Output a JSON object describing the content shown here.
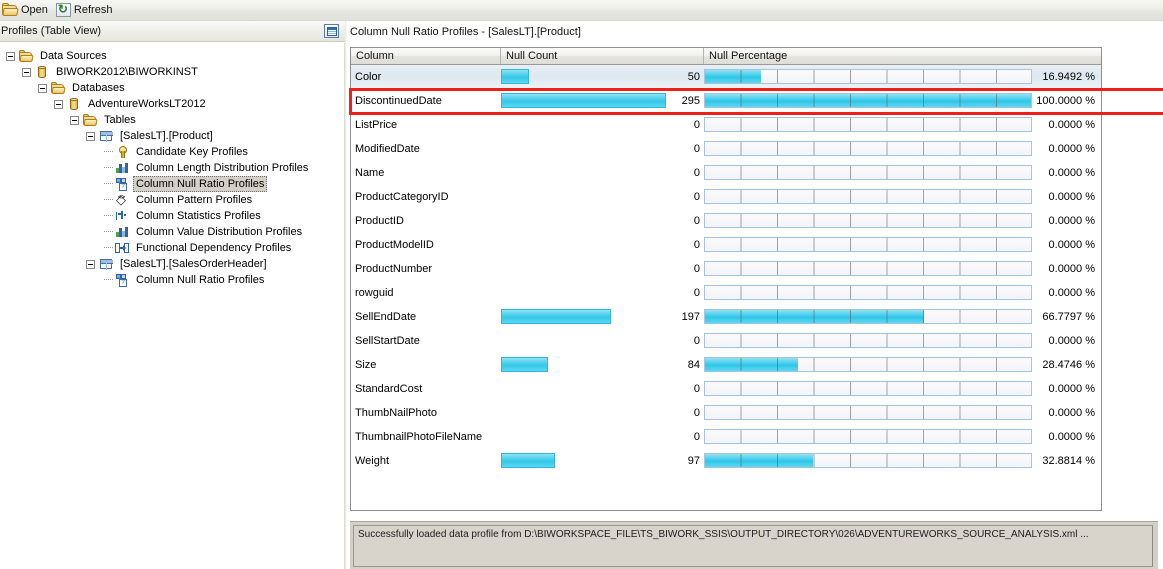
{
  "toolbar": {
    "open_label": "Open",
    "refresh_label": "Refresh",
    "open_icon": "folder-open-icon",
    "refresh_icon": "refresh-icon"
  },
  "left_panel": {
    "header_title": "Profiles (Table View)",
    "view_toggle_icon": "table-view-icon",
    "tree": [
      {
        "label": "Data Sources",
        "depth": 0,
        "icon": "folder-icon",
        "expander": true,
        "selected": false
      },
      {
        "label": "BIWORK2012\\BIWORKINST",
        "depth": 1,
        "icon": "database-server-icon",
        "expander": true,
        "selected": false
      },
      {
        "label": "Databases",
        "depth": 2,
        "icon": "folder-icon",
        "expander": true,
        "selected": false
      },
      {
        "label": "AdventureWorksLT2012",
        "depth": 3,
        "icon": "database-icon",
        "expander": true,
        "selected": false
      },
      {
        "label": "Tables",
        "depth": 4,
        "icon": "folder-icon",
        "expander": true,
        "selected": false
      },
      {
        "label": "[SalesLT].[Product]",
        "depth": 5,
        "icon": "table-icon",
        "expander": true,
        "selected": false
      },
      {
        "label": "Candidate Key Profiles",
        "depth": 6,
        "icon": "key-icon",
        "expander": false,
        "selected": false
      },
      {
        "label": "Column Length Distribution Profiles",
        "depth": 6,
        "icon": "bar-chart-icon",
        "expander": false,
        "selected": false
      },
      {
        "label": "Column Null Ratio Profiles",
        "depth": 6,
        "icon": "null-ratio-icon",
        "expander": false,
        "selected": true
      },
      {
        "label": "Column Pattern Profiles",
        "depth": 6,
        "icon": "pattern-icon",
        "expander": false,
        "selected": false
      },
      {
        "label": "Column Statistics Profiles",
        "depth": 6,
        "icon": "statistics-icon",
        "expander": false,
        "selected": false
      },
      {
        "label": "Column Value Distribution Profiles",
        "depth": 6,
        "icon": "bar-chart-icon",
        "expander": false,
        "selected": false
      },
      {
        "label": "Functional Dependency Profiles",
        "depth": 6,
        "icon": "dependency-icon",
        "expander": false,
        "selected": false
      },
      {
        "label": "[SalesLT].[SalesOrderHeader]",
        "depth": 5,
        "icon": "table-icon",
        "expander": true,
        "selected": false
      },
      {
        "label": "Column Null Ratio Profiles",
        "depth": 6,
        "icon": "null-ratio-icon",
        "expander": false,
        "selected": false
      }
    ]
  },
  "main": {
    "profile_title": "Column Null Ratio Profiles  -  [SalesLT].[Product]",
    "columns": [
      "Column",
      "Null Count",
      "Null Percentage"
    ],
    "percent_suffix": "%",
    "count_bar_max": 295,
    "rows": [
      {
        "column": "Color",
        "null_count": 50,
        "null_percentage": "16.9492",
        "selected": true
      },
      {
        "column": "DiscontinuedDate",
        "null_count": 295,
        "null_percentage": "100.0000",
        "selected": false
      },
      {
        "column": "ListPrice",
        "null_count": 0,
        "null_percentage": "0.0000",
        "selected": false
      },
      {
        "column": "ModifiedDate",
        "null_count": 0,
        "null_percentage": "0.0000",
        "selected": false
      },
      {
        "column": "Name",
        "null_count": 0,
        "null_percentage": "0.0000",
        "selected": false
      },
      {
        "column": "ProductCategoryID",
        "null_count": 0,
        "null_percentage": "0.0000",
        "selected": false
      },
      {
        "column": "ProductID",
        "null_count": 0,
        "null_percentage": "0.0000",
        "selected": false
      },
      {
        "column": "ProductModelID",
        "null_count": 0,
        "null_percentage": "0.0000",
        "selected": false
      },
      {
        "column": "ProductNumber",
        "null_count": 0,
        "null_percentage": "0.0000",
        "selected": false
      },
      {
        "column": "rowguid",
        "null_count": 0,
        "null_percentage": "0.0000",
        "selected": false
      },
      {
        "column": "SellEndDate",
        "null_count": 197,
        "null_percentage": "66.7797",
        "selected": false
      },
      {
        "column": "SellStartDate",
        "null_count": 0,
        "null_percentage": "0.0000",
        "selected": false
      },
      {
        "column": "Size",
        "null_count": 84,
        "null_percentage": "28.4746",
        "selected": false
      },
      {
        "column": "StandardCost",
        "null_count": 0,
        "null_percentage": "0.0000",
        "selected": false
      },
      {
        "column": "ThumbNailPhoto",
        "null_count": 0,
        "null_percentage": "0.0000",
        "selected": false
      },
      {
        "column": "ThumbnailPhotoFileName",
        "null_count": 0,
        "null_percentage": "0.0000",
        "selected": false
      },
      {
        "column": "Weight",
        "null_count": 97,
        "null_percentage": "32.8814",
        "selected": false
      }
    ]
  },
  "status": {
    "message": "Successfully loaded data profile from D:\\BIWORKSPACE_FILE\\TS_BIWORK_SSIS\\OUTPUT_DIRECTORY\\026\\ADVENTUREWORKS_SOURCE_ANALYSIS.xml ..."
  },
  "colors": {
    "bar_fill": "#33c8ea",
    "bar_border": "#31b9d9",
    "highlight_border": "#ee2018",
    "selection_bg": "#d4d0c8",
    "chrome_bg": "#ece9d8"
  },
  "chart_data": {
    "type": "bar",
    "title": "Column Null Ratio Profiles  -  [SalesLT].[Product]",
    "xlabel": "",
    "ylabel": "Column",
    "categories": [
      "Color",
      "DiscontinuedDate",
      "ListPrice",
      "ModifiedDate",
      "Name",
      "ProductCategoryID",
      "ProductID",
      "ProductModelID",
      "ProductNumber",
      "rowguid",
      "SellEndDate",
      "SellStartDate",
      "Size",
      "StandardCost",
      "ThumbNailPhoto",
      "ThumbnailPhotoFileName",
      "Weight"
    ],
    "series": [
      {
        "name": "Null Count",
        "values": [
          50,
          295,
          0,
          0,
          0,
          0,
          0,
          0,
          0,
          0,
          197,
          0,
          84,
          0,
          0,
          0,
          97
        ],
        "range": [
          0,
          295
        ]
      },
      {
        "name": "Null Percentage",
        "values": [
          16.9492,
          100.0,
          0,
          0,
          0,
          0,
          0,
          0,
          0,
          0,
          66.7797,
          0,
          28.4746,
          0,
          0,
          0,
          32.8814
        ],
        "range": [
          0,
          100
        ]
      }
    ],
    "grid": true,
    "legend": "none"
  }
}
